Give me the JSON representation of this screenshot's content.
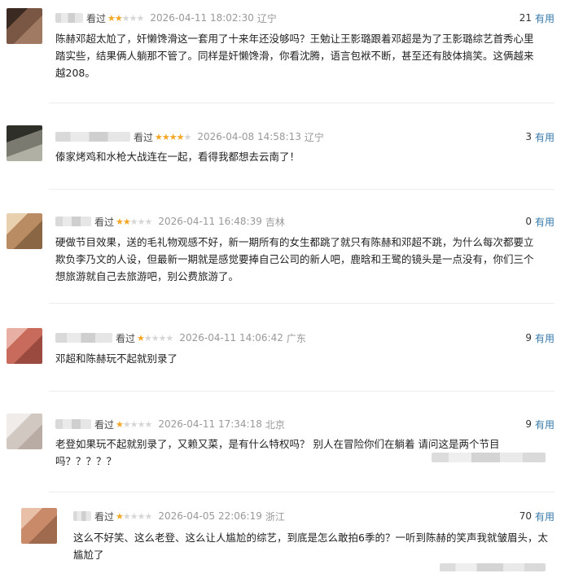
{
  "comments": [
    {
      "watched": "看过",
      "rating": 2,
      "time": "2026-04-11 18:02:30",
      "location": "辽宁",
      "useful_count": "21",
      "useful_label": "有用",
      "avatar_color": "#6b4a3a",
      "lines": [
        "陈赫邓超太尬了，奸懒馋滑这一套用了十来年还没够吗？王勉让王影璐跟着邓超是为了王影璐综艺首秀心里",
        "踏实些，结果俩人躺那不管了。同样是奸懒馋滑，你看沈腾，语言包袱不断，甚至还有肢体搞笑。这俩越来",
        "越208。"
      ]
    },
    {
      "watched": "看过",
      "rating": 4,
      "time": "2026-04-08 14:58:13",
      "location": "辽宁",
      "useful_count": "3",
      "useful_label": "有用",
      "avatar_color": "#5a5a52",
      "lines": [
        "傣家烤鸡和水枪大战连在一起，看得我都想去云南了！"
      ]
    },
    {
      "watched": "看过",
      "rating": 2,
      "time": "2026-04-11 16:48:39",
      "location": "吉林",
      "useful_count": "0",
      "useful_label": "有用",
      "avatar_color": "#c7a27e",
      "lines": [
        "硬做节目效果，送的毛礼物观感不好，新一期所有的女生都跳了就只有陈赫和邓超不跳，为什么每次都要立",
        "欺负李乃文的人设，但最新一期就是感觉要捧自己公司的新人吧，鹿晗和王鹭的镜头是一点没有，你们三个",
        "想旅游就自己去旅游吧，别公费旅游了。"
      ]
    },
    {
      "watched": "看过",
      "rating": 1,
      "time": "2026-04-11 14:06:42",
      "location": "广东",
      "useful_count": "9",
      "useful_label": "有用",
      "avatar_color": "#c76a5e",
      "lines": [
        "邓超和陈赫玩不起就别录了"
      ]
    },
    {
      "watched": "看过",
      "rating": 1,
      "time": "2026-04-11 17:34:18",
      "location": "北京",
      "useful_count": "9",
      "useful_label": "有用",
      "avatar_color": "#d8d0cc",
      "lines": [
        "老登如果玩不起就别录了，又赖又菜，是有什么特权吗？ 别人在冒险你们在躺着 请问这是两个节目",
        "吗？？？？？"
      ]
    },
    {
      "watched": "看过",
      "rating": 1,
      "time": "2026-04-05 22:06:19",
      "location": "浙江",
      "useful_count": "70",
      "useful_label": "有用",
      "avatar_color": "#c98a6a",
      "lines": [
        "这么不好笑、这么老登、这么让人尴尬的综艺，到底是怎么敢拍6季的？一听到陈赫的笑声我就皱眉头，太",
        "尴尬了"
      ]
    }
  ]
}
